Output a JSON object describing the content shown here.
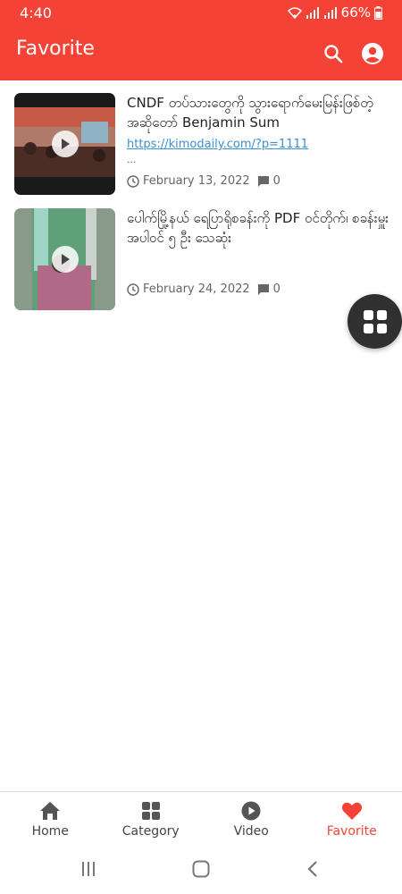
{
  "status_bar": {
    "time": "4:40",
    "battery": "66%"
  },
  "app_bar": {
    "title": "Favorite"
  },
  "articles": [
    {
      "title": "CNDF တပ်သားတွေကို သွားရောက်မေးမြန်းဖြစ်တဲ့ အဆိုတော် Benjamin Sum",
      "link": "https://kimodaily.com/?p=1111",
      "ellipsis": "...",
      "date": "February 13, 2022",
      "comments": "0"
    },
    {
      "title": "ပေါက်မြို့နယ် ရေပြာရိုစခန်းကို PDF ဝင်တိုက်၊ စခန်းမှူး အပါဝင် ၅ ဦး သေဆုံး",
      "date": "February 24, 2022",
      "comments": "0"
    }
  ],
  "bottom_nav": [
    {
      "label": "Home",
      "icon": "home-icon"
    },
    {
      "label": "Category",
      "icon": "grid-icon"
    },
    {
      "label": "Video",
      "icon": "play-circle-icon"
    },
    {
      "label": "Favorite",
      "icon": "heart-icon",
      "active": true
    }
  ],
  "colors": {
    "primary": "#f44336",
    "accent_link": "#3b8fd6",
    "fab": "#303030"
  }
}
